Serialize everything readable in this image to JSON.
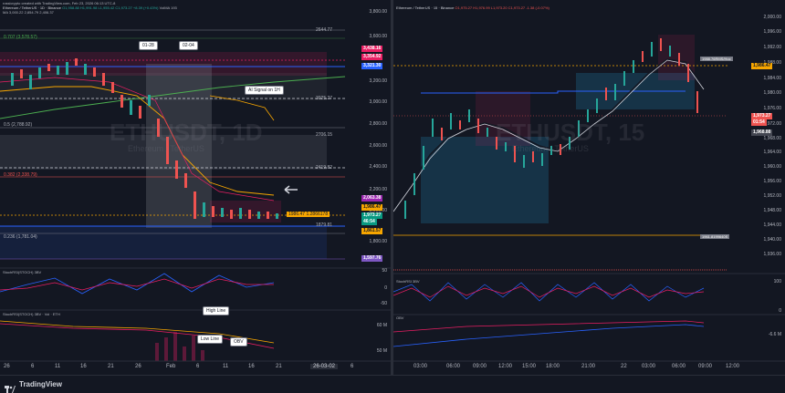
{
  "left": {
    "meta_line": "rossicrypto created with TradingView.com, Feb 23, 2026 06:13 UTC-8",
    "symbol_line": "Ethereum / TetherUS · 1D · Binance",
    "ohlc_line": "O1,958.88 H1,991.98 L1,955.42 C1,973.27 +8.39 (+0.43%)",
    "ind_line": "VolMA 193",
    "ind2_line": "MA 3,000.22 2,854.79 2,406.37",
    "watermark_symbol": "ETHUSDT, 1D",
    "watermark_name": "Ethereum / TetherUS",
    "fib_labels": [
      "0.707 (3,578.57)",
      "0.5 (2,788.92)",
      "0.382 (2,338.79)",
      "0.236 (1,781.04)"
    ],
    "price_scale": [
      "3,800.00",
      "3,600.00",
      "3,200.00",
      "3,000.00",
      "2,800.00",
      "2,600.00",
      "2,400.00",
      "2,200.00",
      "2,000.00",
      "1,800.00"
    ],
    "level_labels": [
      "2644.77",
      "3025.27",
      "2706.15",
      "2419.82",
      "1879.81",
      "1986.47 1.2866178"
    ],
    "tags": [
      {
        "text": "3,438.16",
        "color": "#e91e63"
      },
      {
        "text": "3,354.92",
        "color": "#e91e63"
      },
      {
        "text": "3,321.30",
        "color": "#2962ff"
      },
      {
        "text": "2,063.38",
        "color": "#9c27b0"
      },
      {
        "text": "1,986.47",
        "color": "#f7a600"
      },
      {
        "text": "1,973.27",
        "color": "#089981"
      },
      {
        "text": "46:54",
        "color": "#089981"
      },
      {
        "text": "1,861.57",
        "color": "#f7a600"
      },
      {
        "text": "1,597.76",
        "color": "#7e57c2"
      }
    ],
    "callouts": [
      "01-28",
      "02-04",
      "AI Signal on 1H",
      "High Line",
      "Low Line",
      "OBV"
    ],
    "stoch_label": "StochRSI(STOCH) 3BV",
    "stoch_scale": [
      "50",
      "0",
      "-50"
    ],
    "vol_label": "StochRSI(STOCH) 3BV · Vol · ETH",
    "vol_scale": [
      "60 M",
      "50 M"
    ],
    "x_labels": [
      "26",
      "6",
      "11",
      "16",
      "21",
      "26",
      "Feb",
      "6",
      "11",
      "16",
      "21"
    ],
    "x_highlight": "26-03-02",
    "x_last": "6"
  },
  "right": {
    "symbol_line": "Ethereum / TetherUS · 15 · Binance",
    "ohlc_line": "O1,975.27 H1,976.99 L1,973.20 C1,973.27 -1.38 (-0.07%)",
    "watermark_symbol": "ETHUSDT, 15",
    "watermark_name": "Ethereum / TetherUS",
    "price_scale": [
      "2,000.00",
      "1,996.00",
      "1,992.00",
      "1,988.00",
      "1,984.00",
      "1,980.00",
      "1,976.00",
      "1,972.00",
      "1,968.00",
      "1,964.00",
      "1,960.00",
      "1,956.00",
      "1,952.00",
      "1,948.00",
      "1,944.00",
      "1,940.00",
      "1,936.00"
    ],
    "tags": [
      {
        "text": "1,986.47",
        "color": "#f7a600"
      },
      {
        "text": "1,973.27",
        "color": "#ef5350"
      },
      {
        "text": "01:54",
        "color": "#ef5350"
      },
      {
        "text": "1,968.88",
        "color": "#434651"
      }
    ],
    "level_labels": [
      "1988.76RMS/Hoc",
      "1961.8199640S"
    ],
    "stoch_label": "StochRSI 3BV",
    "stoch_scale": [
      "100",
      "0"
    ],
    "obv_label": "OBV",
    "obv_scale": [
      "-6.6 M"
    ],
    "x_labels": [
      "03:00",
      "06:00",
      "09:00",
      "12:00",
      "15:00",
      "18:00",
      "21:00",
      "22",
      "03:00",
      "06:00",
      "09:00",
      "12:00"
    ]
  },
  "footer": {
    "brand": "TradingView"
  },
  "colors": {
    "bg": "#131722",
    "up": "#26a69a",
    "down": "#ef5350"
  }
}
